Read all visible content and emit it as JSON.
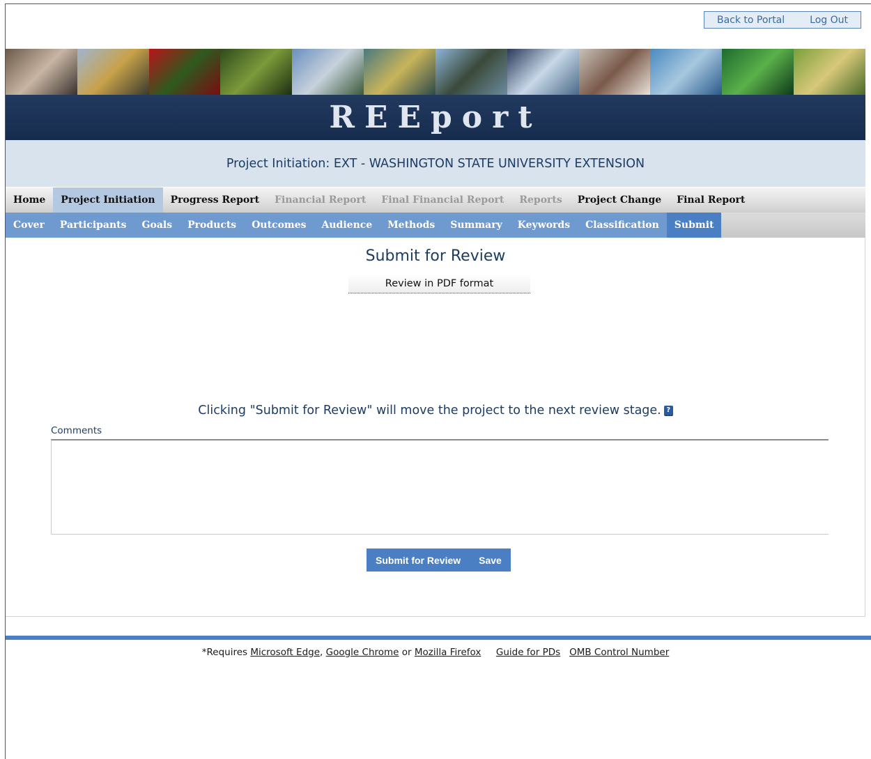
{
  "header": {
    "back_to_portal": "Back to Portal",
    "log_out": "Log Out",
    "logo": "REEport",
    "photos": [
      {
        "name": "scientist-photo",
        "colors": [
          "#6b5a4a",
          "#c9b5a3",
          "#3a3330"
        ]
      },
      {
        "name": "excavator-photo",
        "colors": [
          "#9fb5cf",
          "#c9a24a",
          "#3a3a2e"
        ]
      },
      {
        "name": "flower-photo",
        "colors": [
          "#b8141a",
          "#2e5a1e",
          "#7a0c10"
        ]
      },
      {
        "name": "forest-photo",
        "colors": [
          "#2f4a1d",
          "#7b9a3a",
          "#1d2e12"
        ]
      },
      {
        "name": "mountain-photo",
        "colors": [
          "#6a8fc0",
          "#c7d2dc",
          "#3c5a3a"
        ]
      },
      {
        "name": "bird-photo",
        "colors": [
          "#4a7a7e",
          "#c8b45a",
          "#2e4a4a"
        ]
      },
      {
        "name": "cattle-photo",
        "colors": [
          "#8db4d8",
          "#3a4a3a",
          "#6a8a9e"
        ]
      },
      {
        "name": "waterfall-photo",
        "colors": [
          "#2a3a5a",
          "#c8d8e8",
          "#4a6a8a"
        ]
      },
      {
        "name": "microscope-photo",
        "colors": [
          "#c8c0b8",
          "#7a5a4a",
          "#e8e0d8"
        ]
      },
      {
        "name": "dolphin-photo",
        "colors": [
          "#4a8ac0",
          "#a8c8e0",
          "#2a5a8a"
        ]
      },
      {
        "name": "leaf-photo",
        "colors": [
          "#1e6a2e",
          "#5ab04a",
          "#0e3a1a"
        ]
      },
      {
        "name": "field-photo",
        "colors": [
          "#7aa03a",
          "#d8c87a",
          "#4a6a2a"
        ]
      }
    ]
  },
  "project_title": "Project Initiation: EXT - WASHINGTON STATE UNIVERSITY EXTENSION",
  "nav_primary": [
    {
      "label": "Home",
      "state": "normal"
    },
    {
      "label": "Project Initiation",
      "state": "active"
    },
    {
      "label": "Progress Report",
      "state": "normal"
    },
    {
      "label": "Financial Report",
      "state": "disabled"
    },
    {
      "label": "Final Financial Report",
      "state": "disabled"
    },
    {
      "label": "Reports",
      "state": "disabled"
    },
    {
      "label": "Project Change",
      "state": "normal"
    },
    {
      "label": "Final Report",
      "state": "normal"
    }
  ],
  "nav_secondary": [
    {
      "label": "Cover",
      "state": "normal"
    },
    {
      "label": "Participants",
      "state": "normal"
    },
    {
      "label": "Goals",
      "state": "normal"
    },
    {
      "label": "Products",
      "state": "normal"
    },
    {
      "label": "Outcomes",
      "state": "normal"
    },
    {
      "label": "Audience",
      "state": "normal"
    },
    {
      "label": "Methods",
      "state": "normal"
    },
    {
      "label": "Summary",
      "state": "normal"
    },
    {
      "label": "Keywords",
      "state": "normal"
    },
    {
      "label": "Classification",
      "state": "normal"
    },
    {
      "label": "Submit",
      "state": "active"
    }
  ],
  "main": {
    "title": "Submit for Review",
    "pdf_link": "Review in PDF format",
    "notice": "Clicking \"Submit for Review\" will move the project to the next review stage.",
    "help_icon": "?",
    "comments_label": "Comments",
    "comments_value": "",
    "submit_button": "Submit for Review",
    "save_button": "Save"
  },
  "footer": {
    "requires": "*Requires ",
    "edge": "Microsoft Edge",
    "comma": ", ",
    "chrome": "Google Chrome",
    "or": " or ",
    "firefox": "Mozilla Firefox",
    "guide": "Guide for PDs",
    "omb": "OMB Control Number"
  }
}
